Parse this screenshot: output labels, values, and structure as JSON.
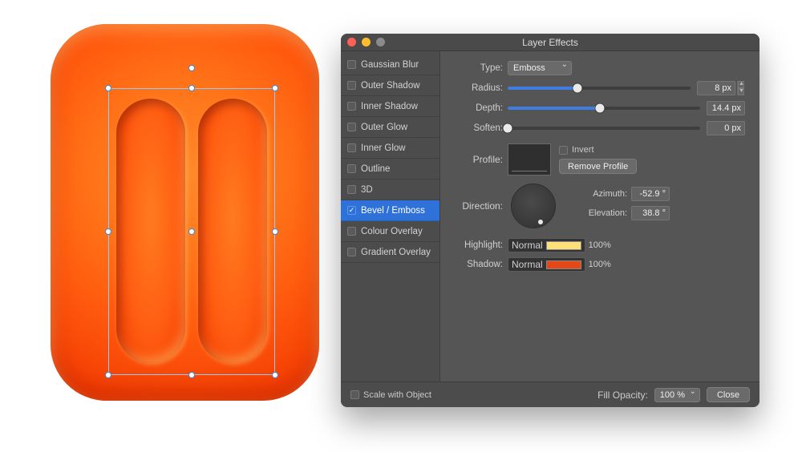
{
  "dialog": {
    "title": "Layer Effects",
    "sidebar": {
      "items": [
        {
          "label": "Gaussian Blur",
          "checked": false
        },
        {
          "label": "Outer Shadow",
          "checked": false
        },
        {
          "label": "Inner Shadow",
          "checked": false
        },
        {
          "label": "Outer Glow",
          "checked": false
        },
        {
          "label": "Inner Glow",
          "checked": false
        },
        {
          "label": "Outline",
          "checked": false
        },
        {
          "label": "3D",
          "checked": false
        },
        {
          "label": "Bevel / Emboss",
          "checked": true,
          "selected": true
        },
        {
          "label": "Colour Overlay",
          "checked": false
        },
        {
          "label": "Gradient Overlay",
          "checked": false
        }
      ]
    },
    "fields": {
      "type_label": "Type:",
      "type_value": "Emboss",
      "radius_label": "Radius:",
      "radius_value": "8 px",
      "radius_pct": 38,
      "depth_label": "Depth:",
      "depth_value": "14.4 px",
      "depth_pct": 48,
      "soften_label": "Soften:",
      "soften_value": "0 px",
      "soften_pct": 0,
      "profile_label": "Profile:",
      "invert_label": "Invert",
      "remove_profile_label": "Remove Profile",
      "direction_label": "Direction:",
      "azimuth_label": "Azimuth:",
      "azimuth_value": "-52.9 °",
      "elevation_label": "Elevation:",
      "elevation_value": "38.8 °",
      "highlight_label": "Highlight:",
      "highlight_blend": "Normal",
      "highlight_color": "#ffe079",
      "highlight_pct": "100%",
      "shadow_label": "Shadow:",
      "shadow_blend": "Normal",
      "shadow_color": "#e34817",
      "shadow_pct": "100%"
    },
    "footer": {
      "scale_label": "Scale with Object",
      "fill_opacity_label": "Fill Opacity:",
      "fill_opacity_value": "100 %",
      "close_label": "Close"
    }
  }
}
